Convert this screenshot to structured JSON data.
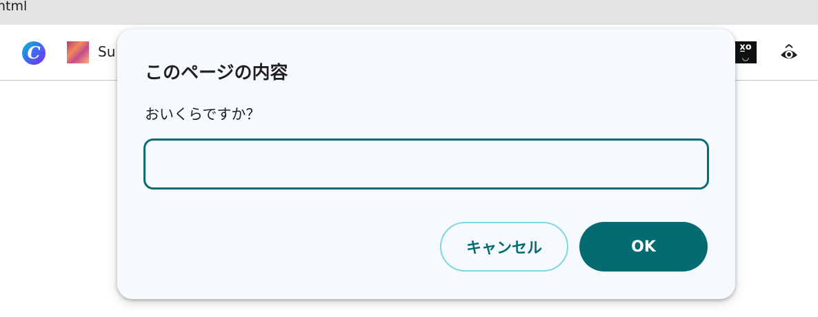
{
  "browser": {
    "tab_title": "html",
    "bookmarks": [
      {
        "label": "",
        "icon": "canva-icon",
        "glyph": "C"
      },
      {
        "label": "Su",
        "icon": "bookmark-thumbnail-icon"
      }
    ],
    "extensions": [
      {
        "icon": "extension-emoji-icon",
        "glyph": "x̲o"
      },
      {
        "icon": "eye-extension-icon"
      }
    ]
  },
  "dialog": {
    "title": "このページの内容",
    "message": "おいくらですか？",
    "input": {
      "value": "",
      "placeholder": ""
    },
    "cancel_label": "キャンセル",
    "ok_label": "OK"
  },
  "colors": {
    "accent": "#056b73",
    "cancel_border": "#7fd6df",
    "dialog_bg": "#f6fafe",
    "tab_strip_bg": "#e3e3e3"
  }
}
